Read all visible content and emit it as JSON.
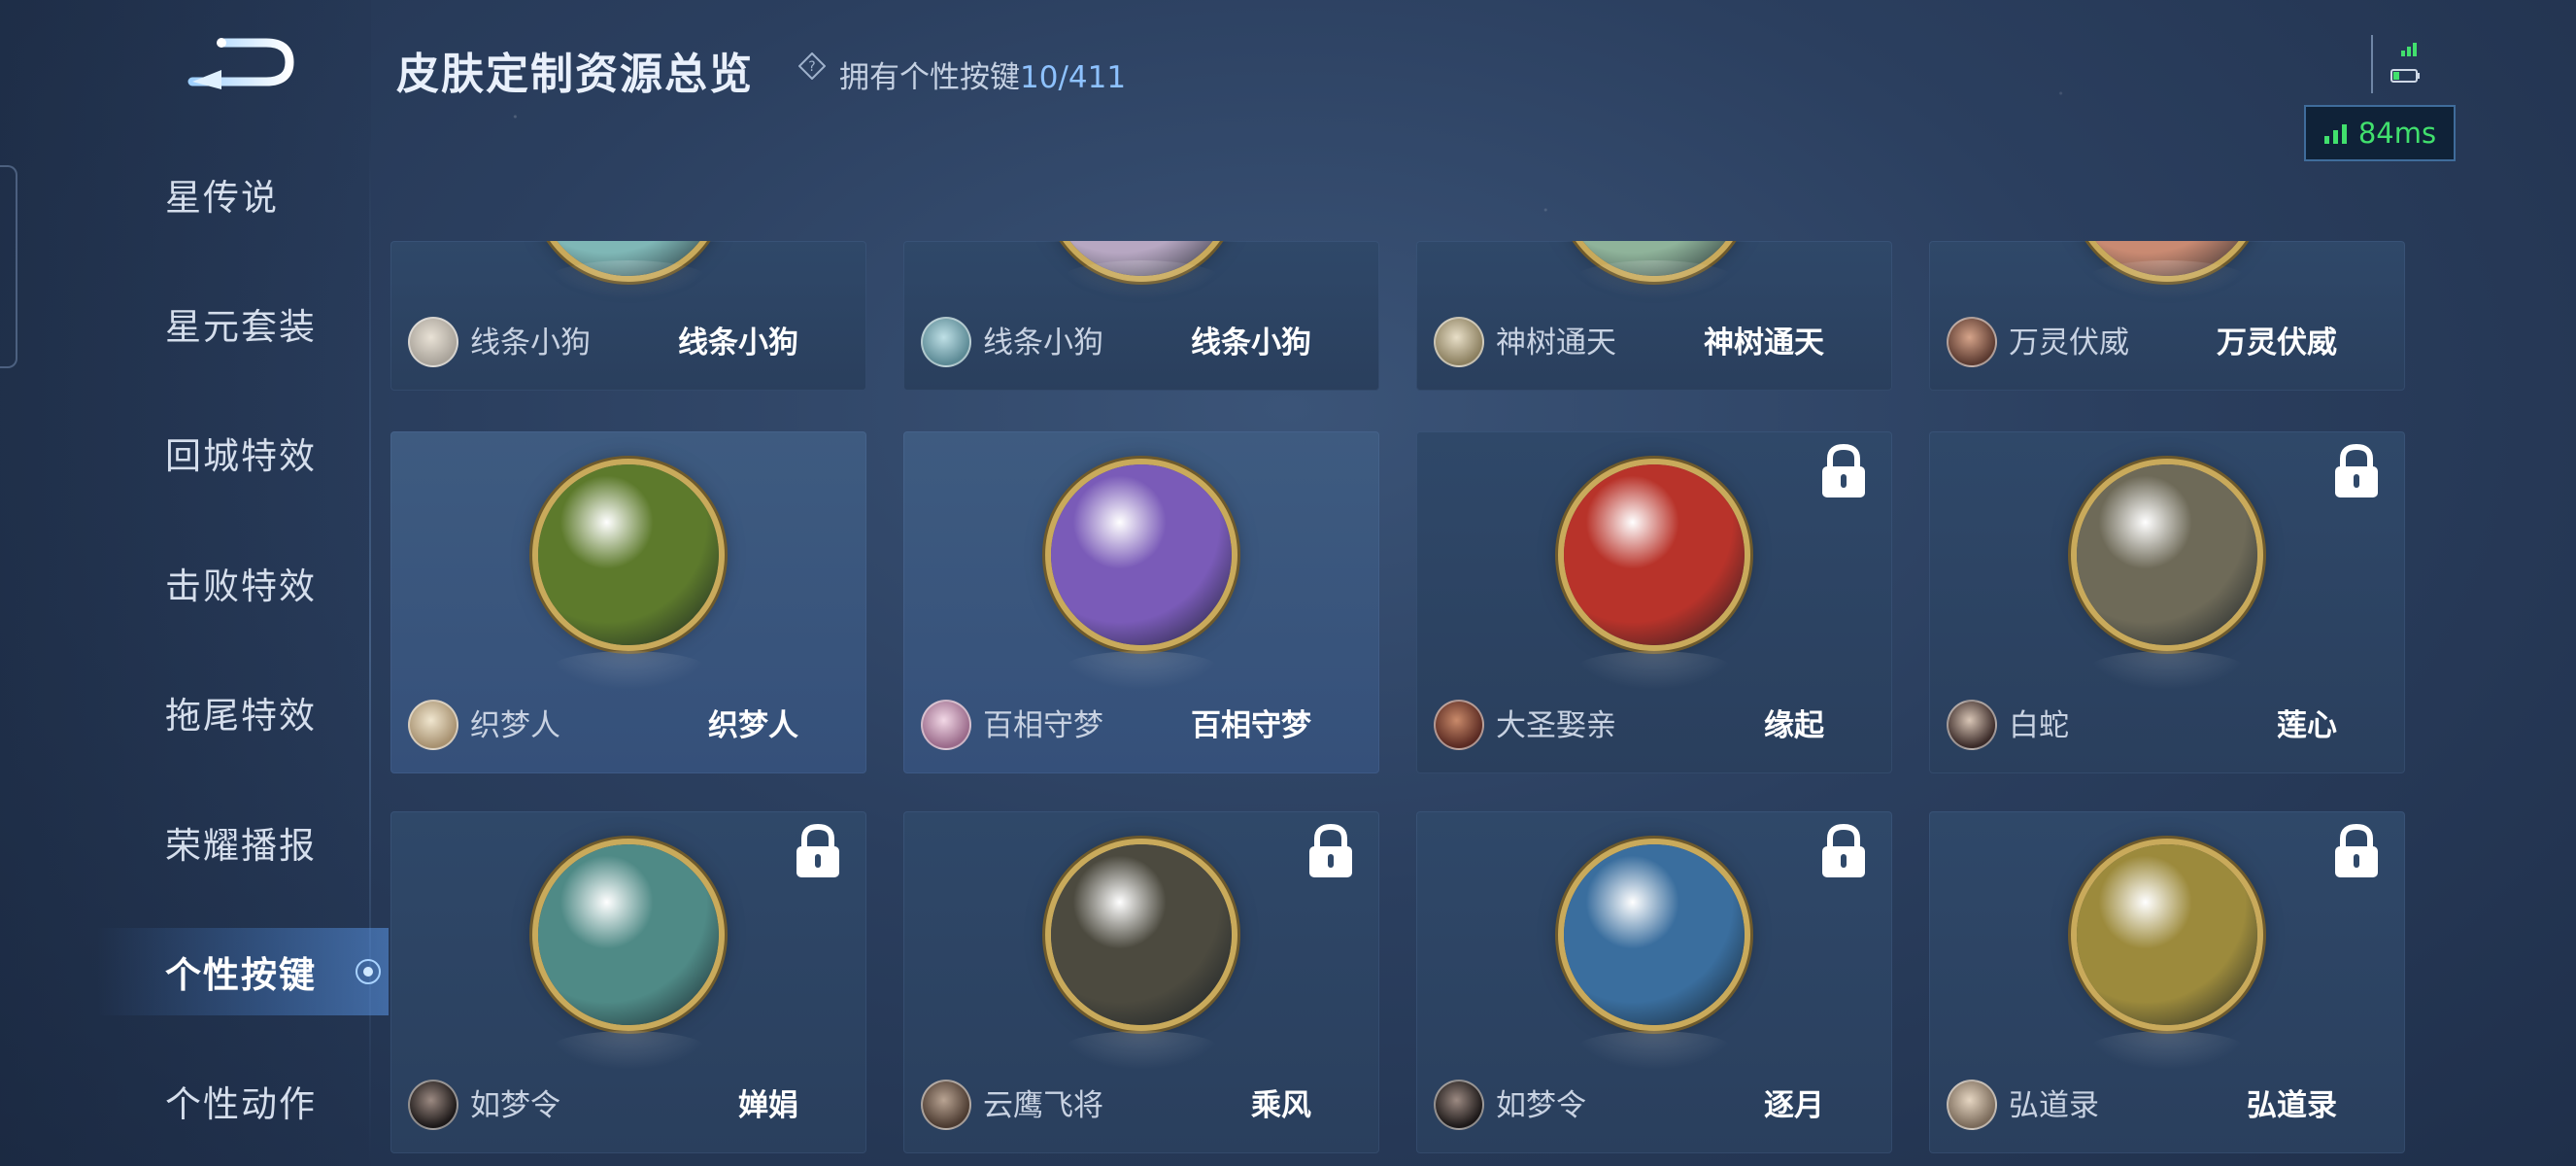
{
  "header": {
    "title": "皮肤定制资源总览",
    "owned_label": "拥有个性按键",
    "owned_count": "10/411",
    "ping": "84ms"
  },
  "sidebar": {
    "items": [
      {
        "label": "星传说"
      },
      {
        "label": "星元套装"
      },
      {
        "label": "回城特效"
      },
      {
        "label": "击败特效"
      },
      {
        "label": "拖尾特效"
      },
      {
        "label": "荣耀播报"
      },
      {
        "label": "个性按键",
        "active": true
      },
      {
        "label": "个性动作"
      }
    ]
  },
  "grid": {
    "top_row": [
      {
        "hero": "线条小狗",
        "skin": "线条小狗",
        "orb": "#7fb7b6"
      },
      {
        "hero": "线条小狗",
        "skin": "线条小狗",
        "orb": "#b7a7c2"
      },
      {
        "hero": "神树通天",
        "skin": "神树通天",
        "orb": "#8fb39a"
      },
      {
        "hero": "万灵伏威",
        "skin": "万灵伏威",
        "orb": "#c98a72"
      }
    ],
    "mid_row": [
      {
        "hero": "织梦人",
        "skin": "织梦人",
        "locked": false,
        "orb": "#5d7a2c"
      },
      {
        "hero": "百相守梦",
        "skin": "百相守梦",
        "locked": false,
        "orb": "#7a5bb8"
      },
      {
        "hero": "大圣娶亲",
        "skin": "缘起",
        "locked": true,
        "orb": "#b8332a"
      },
      {
        "hero": "白蛇",
        "skin": "莲心",
        "locked": true,
        "orb": "#6e6a58"
      }
    ],
    "bottom_row": [
      {
        "hero": "如梦令",
        "skin": "婵娟",
        "locked": true,
        "orb": "#4f8a86"
      },
      {
        "hero": "云鹰飞将",
        "skin": "乘风",
        "locked": true,
        "orb": "#4c4a3f"
      },
      {
        "hero": "如梦令",
        "skin": "逐月",
        "locked": true,
        "orb": "#3a6e9e"
      },
      {
        "hero": "弘道录",
        "skin": "弘道录",
        "locked": true,
        "orb": "#9c8a3c"
      }
    ]
  },
  "colors": {
    "accent": "#8ec2ff",
    "ping_green": "#41e06d",
    "gold_ring": "#c9aa5b"
  }
}
